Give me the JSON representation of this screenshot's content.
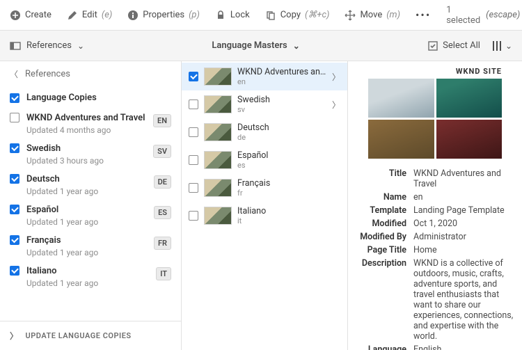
{
  "toolbar": {
    "create": "Create",
    "edit": "Edit",
    "edit_key": "(e)",
    "properties": "Properties",
    "properties_key": "(p)",
    "lock": "Lock",
    "copy": "Copy",
    "copy_key": "(⌘+c)",
    "move": "Move",
    "move_key": "(m)",
    "selected": "1 selected",
    "escape": "(escape)"
  },
  "secbar": {
    "references": "References",
    "title": "Language Masters",
    "select_all": "Select All"
  },
  "refs": {
    "header": "References",
    "group": "Language Copies",
    "items": [
      {
        "name": "WKND Adventures and Travel",
        "sub": "Updated 4 months ago",
        "badge": "EN",
        "checked": false
      },
      {
        "name": "Swedish",
        "sub": "Updated 3 hours ago",
        "badge": "SV",
        "checked": true
      },
      {
        "name": "Deutsch",
        "sub": "Updated 1 year ago",
        "badge": "DE",
        "checked": true
      },
      {
        "name": "Español",
        "sub": "Updated 1 year ago",
        "badge": "ES",
        "checked": true
      },
      {
        "name": "Français",
        "sub": "Updated 1 year ago",
        "badge": "FR",
        "checked": true
      },
      {
        "name": "Italiano",
        "sub": "Updated 1 year ago",
        "badge": "IT",
        "checked": true
      }
    ],
    "update": "UPDATE LANGUAGE COPIES"
  },
  "mid": {
    "items": [
      {
        "title": "WKND Adventures and Travel",
        "sub": "en",
        "selected": true,
        "checked": true,
        "arrow": true
      },
      {
        "title": "Swedish",
        "sub": "sv",
        "selected": false,
        "checked": false,
        "arrow": true
      },
      {
        "title": "Deutsch",
        "sub": "de",
        "selected": false,
        "checked": false,
        "arrow": false
      },
      {
        "title": "Español",
        "sub": "es",
        "selected": false,
        "checked": false,
        "arrow": false
      },
      {
        "title": "Français",
        "sub": "fr",
        "selected": false,
        "checked": false,
        "arrow": false
      },
      {
        "title": "Italiano",
        "sub": "it",
        "selected": false,
        "checked": false,
        "arrow": false
      }
    ]
  },
  "preview": {
    "brand": "WKND SITE"
  },
  "meta": {
    "title_k": "Title",
    "title_v": "WKND Adventures and Travel",
    "name_k": "Name",
    "name_v": "en",
    "template_k": "Template",
    "template_v": "Landing Page Template",
    "modified_k": "Modified",
    "modified_v": "Oct 1, 2020",
    "modifiedby_k": "Modified By",
    "modifiedby_v": "Administrator",
    "pagetitle_k": "Page Title",
    "pagetitle_v": "Home",
    "desc_k": "Description",
    "desc_v": "WKND is a collective of outdoors, music, crafts, adventure sports, and travel enthusiasts that want to share our experiences, connections, and expertise with the world.",
    "lang_k": "Language",
    "lang_v": "English"
  }
}
